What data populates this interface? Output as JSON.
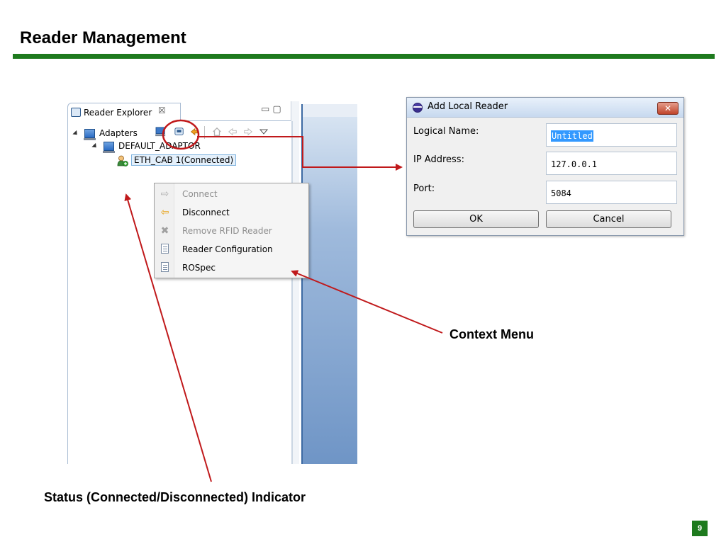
{
  "slide": {
    "title": "Reader Management",
    "page_number": "9",
    "accent_color": "#1e7a1e"
  },
  "explorer": {
    "tab_label": "Reader Explorer",
    "tab_close": "☒",
    "minmax": "▭ ▢",
    "tree": {
      "root_label": "Adapters",
      "adaptor_label": "DEFAULT_ADAPTOR",
      "reader_label": "ETH_CAB 1(Connected)"
    }
  },
  "context_menu": {
    "items": [
      {
        "label": "Connect",
        "icon": "arrow-right-icon",
        "enabled": false
      },
      {
        "label": "Disconnect",
        "icon": "arrow-left-icon",
        "enabled": true
      },
      {
        "label": "Remove RFID Reader",
        "icon": "x-icon",
        "enabled": false
      },
      {
        "label": "Reader Configuration",
        "icon": "document-icon",
        "enabled": true
      },
      {
        "label": "ROSpec",
        "icon": "document-icon",
        "enabled": true
      }
    ]
  },
  "dialog": {
    "title": "Add Local Reader",
    "close_label": "✕",
    "fields": [
      {
        "label": "Logical Name:",
        "value": "Untitled"
      },
      {
        "label": "IP Address:",
        "value": "127.0.0.1"
      },
      {
        "label": "Port:",
        "value": "5084"
      }
    ],
    "ok_label": "OK",
    "cancel_label": "Cancel"
  },
  "annotations": {
    "context_menu_label": "Context Menu",
    "status_label": "Status (Connected/Disconnected) Indicator",
    "arrow_color": "#c0191b"
  }
}
